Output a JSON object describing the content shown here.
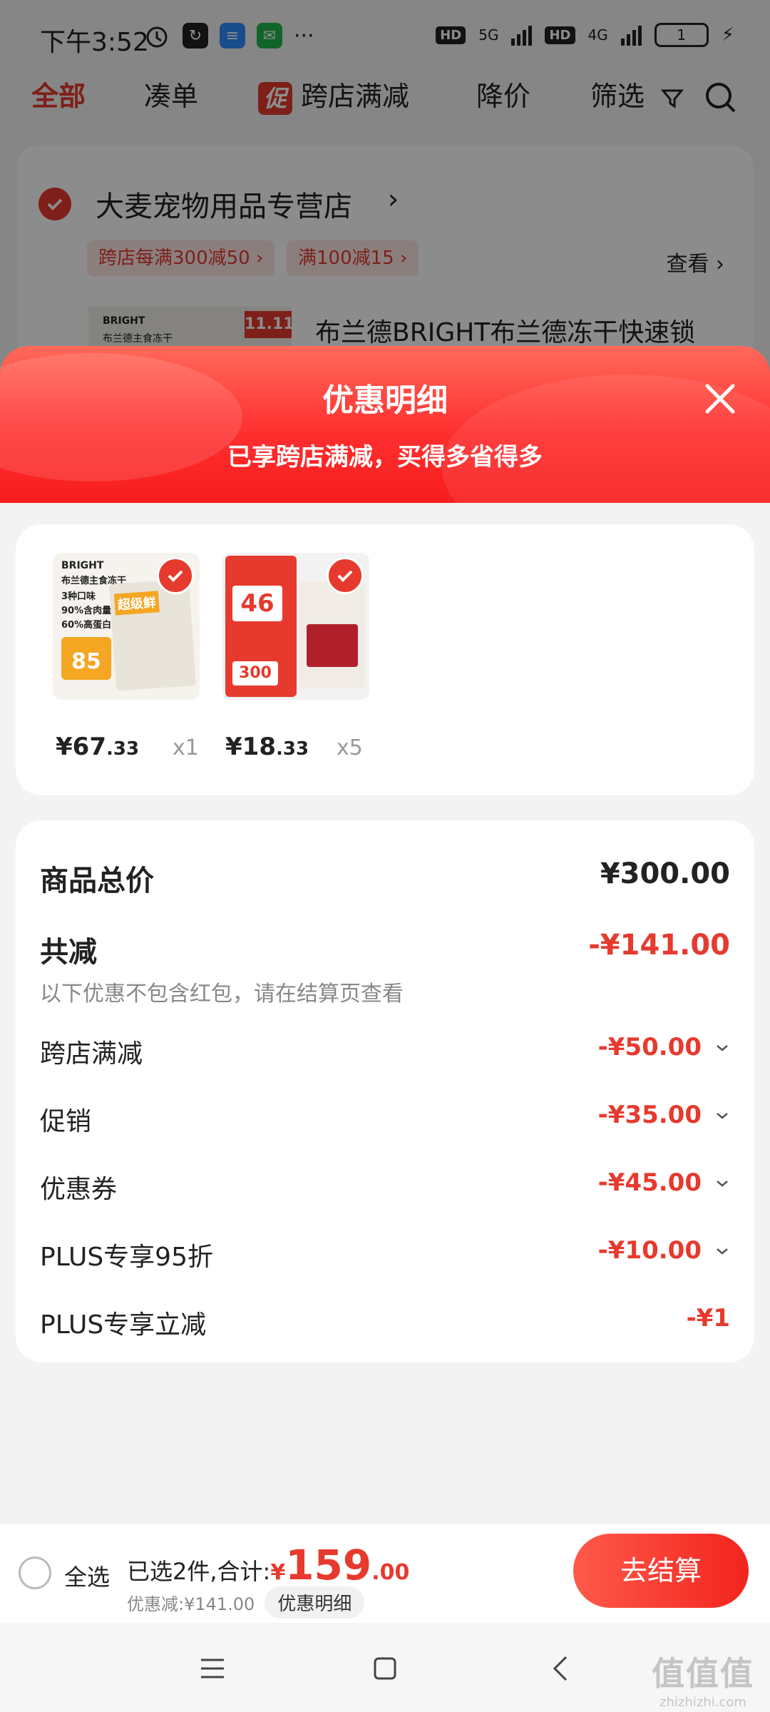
{
  "status_bar": {
    "time": "下午3:52",
    "network1": "5G",
    "network2": "4G",
    "hd": "HD",
    "battery": "1",
    "more": "···"
  },
  "top_tabs": {
    "all": "全部",
    "bundle": "凑单",
    "promo_badge": "促",
    "cross_store": "跨店满减",
    "price_drop": "降价",
    "filter": "筛选"
  },
  "store": {
    "name": "大麦宠物用品专营店",
    "coupon1": "跨店每满300减50",
    "coupon2": "满100减15",
    "view": "查看",
    "product_title": "布兰德BRIGHT布兰德冻干快速锁",
    "thumb_brand": "BRIGHT",
    "thumb_name": "布兰德主食冻干",
    "thumb_tag": "11.11"
  },
  "sheet": {
    "title": "优惠明细",
    "subtitle": "已享跨店满减，买得多省得多"
  },
  "products": [
    {
      "price_int": "¥67",
      "price_dec": ".33",
      "qty": "x1",
      "art": {
        "brand": "BRIGHT",
        "name": "布兰德主食冻干",
        "line1": "3种口味",
        "line2": "90%含肉量",
        "line3": "60%高蛋白",
        "tag": "超级鲜",
        "big": "85"
      }
    },
    {
      "price_int": "¥18",
      "price_dec": ".33",
      "qty": "x5",
      "art": {
        "n1": "46",
        "n2": "300"
      }
    }
  ],
  "summary": {
    "total_label": "商品总价",
    "total_value": "¥300.00",
    "reduce_label": "共减",
    "reduce_value": "-¥141.00",
    "note": "以下优惠不包含红包，请在结算页查看",
    "items": [
      {
        "label": "跨店满减",
        "value": "-¥50.00",
        "has_chevron": true
      },
      {
        "label": "促销",
        "value": "-¥35.00",
        "has_chevron": true
      },
      {
        "label": "优惠券",
        "value": "-¥45.00",
        "has_chevron": true
      },
      {
        "label": "PLUS专享95折",
        "value": "-¥10.00",
        "has_chevron": true
      },
      {
        "label": "PLUS专享立减",
        "value": "-¥1",
        "has_chevron": false
      }
    ]
  },
  "bottom_bar": {
    "select_all": "全选",
    "selected_text": "已选2件,合计:",
    "currency": "¥",
    "total_int": "159",
    "total_dec": ".00",
    "discount_text": "优惠减:¥141.00",
    "detail_chip": "优惠明细",
    "checkout": "去结算"
  },
  "watermark": {
    "logo": "值值值",
    "url": "zhizhizhi.com"
  },
  "colors": {
    "accent": "#e63a2e",
    "header_gradient_start": "#ff6a5a",
    "header_gradient_end": "#f71d1d"
  }
}
